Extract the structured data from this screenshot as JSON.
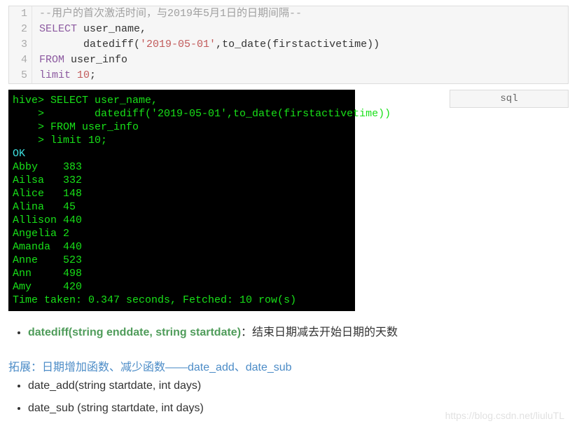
{
  "code": {
    "lines": [
      {
        "n": "1",
        "segments": [
          {
            "cls": "c-comment",
            "text": "--用户的首次激活时间，与2019年5月1日的日期间隔--"
          }
        ]
      },
      {
        "n": "2",
        "segments": [
          {
            "cls": "c-keyword",
            "text": "SELECT"
          },
          {
            "cls": "c-ident",
            "text": " user_name,"
          }
        ]
      },
      {
        "n": "3",
        "segments": [
          {
            "cls": "c-ident",
            "text": "       "
          },
          {
            "cls": "c-func",
            "text": "datediff("
          },
          {
            "cls": "c-string",
            "text": "'2019-05-01'"
          },
          {
            "cls": "c-func",
            "text": ",to_date(firstactivetime))"
          }
        ]
      },
      {
        "n": "4",
        "segments": [
          {
            "cls": "c-keyword",
            "text": "FROM"
          },
          {
            "cls": "c-ident",
            "text": " user_info"
          }
        ]
      },
      {
        "n": "5",
        "segments": [
          {
            "cls": "c-keyword",
            "text": "limit"
          },
          {
            "cls": "c-ident",
            "text": " "
          },
          {
            "cls": "c-number",
            "text": "10"
          },
          {
            "cls": "c-ident",
            "text": ";"
          }
        ]
      }
    ]
  },
  "sql_badge": "sql",
  "terminal": {
    "query_lines": [
      "hive> SELECT user_name,",
      "    >        datediff('2019-05-01',to_date(firstactivetime))",
      "    > FROM user_info",
      "    > limit 10;"
    ],
    "ok": "OK",
    "rows": [
      {
        "name": "Abby",
        "val": "383"
      },
      {
        "name": "Ailsa",
        "val": "332"
      },
      {
        "name": "Alice",
        "val": "148"
      },
      {
        "name": "Alina",
        "val": "45"
      },
      {
        "name": "Allison",
        "val": "440"
      },
      {
        "name": "Angelia",
        "val": "2"
      },
      {
        "name": "Amanda",
        "val": "440"
      },
      {
        "name": "Anne",
        "val": "523"
      },
      {
        "name": "Ann",
        "val": "498"
      },
      {
        "name": "Amy",
        "val": "420"
      }
    ],
    "footer": "Time taken: 0.347 seconds, Fetched: 10 row(s)"
  },
  "explain": {
    "func": "datediff(string enddate, string startdate)",
    "desc": "：结束日期减去开始日期的天数"
  },
  "expand": {
    "title": "拓展：日期增加函数、减少函数——date_add、date_sub",
    "items": [
      "date_add(string startdate, int days)",
      "date_sub (string startdate, int days)"
    ]
  },
  "watermark": "https://blog.csdn.net/liuluTL"
}
